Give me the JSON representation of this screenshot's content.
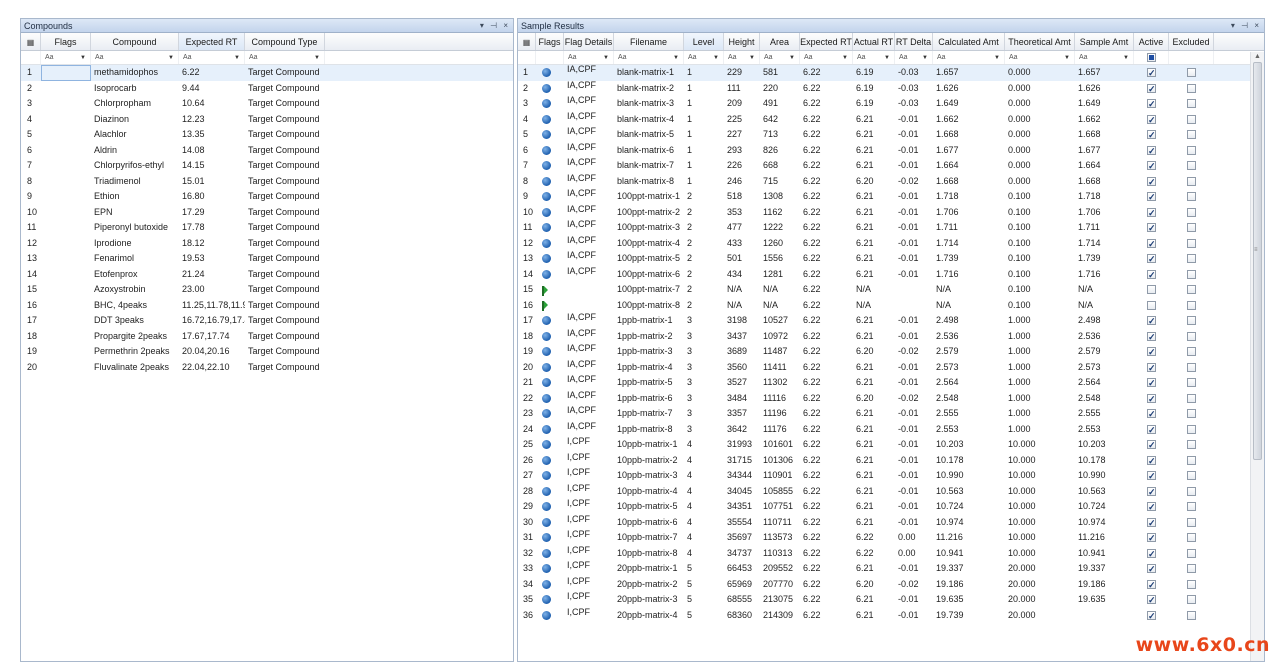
{
  "compounds_panel": {
    "title": "Compounds",
    "columns": [
      "",
      "Flags",
      "Compound",
      "Expected RT",
      "Compound Type"
    ],
    "filter_token": "Aa",
    "rows": [
      [
        "1",
        "",
        "methamidophos",
        "6.22",
        "Target Compound"
      ],
      [
        "2",
        "",
        "Isoprocarb",
        "9.44",
        "Target Compound"
      ],
      [
        "3",
        "",
        "Chlorpropham",
        "10.64",
        "Target Compound"
      ],
      [
        "4",
        "",
        "Diazinon",
        "12.23",
        "Target Compound"
      ],
      [
        "5",
        "",
        "Alachlor",
        "13.35",
        "Target Compound"
      ],
      [
        "6",
        "",
        "Aldrin",
        "14.08",
        "Target Compound"
      ],
      [
        "7",
        "",
        "Chlorpyrifos-ethyl",
        "14.15",
        "Target Compound"
      ],
      [
        "8",
        "",
        "Triadimenol",
        "15.01",
        "Target Compound"
      ],
      [
        "9",
        "",
        "Ethion",
        "16.80",
        "Target Compound"
      ],
      [
        "10",
        "",
        "EPN",
        "17.29",
        "Target Compound"
      ],
      [
        "11",
        "",
        "Piperonyl butoxide",
        "17.78",
        "Target Compound"
      ],
      [
        "12",
        "",
        "Iprodione",
        "18.12",
        "Target Compound"
      ],
      [
        "13",
        "",
        "Fenarimol",
        "19.53",
        "Target Compound"
      ],
      [
        "14",
        "",
        "Etofenprox",
        "21.24",
        "Target Compound"
      ],
      [
        "15",
        "",
        "Azoxystrobin",
        "23.00",
        "Target Compound"
      ],
      [
        "16",
        "",
        "BHC, 4peaks",
        "11.25,11.78,11.9",
        "Target Compound"
      ],
      [
        "17",
        "",
        "DDT 3peaks",
        "16.72,16.79,17.4",
        "Target Compound"
      ],
      [
        "18",
        "",
        "Propargite 2peaks",
        "17.67,17.74",
        "Target Compound"
      ],
      [
        "19",
        "",
        "Permethrin 2peaks",
        "20.04,20.16",
        "Target Compound"
      ],
      [
        "20",
        "",
        "Fluvalinate 2peaks",
        "22.04,22.10",
        "Target Compound"
      ]
    ]
  },
  "results_panel": {
    "title": "Sample Results",
    "columns": [
      "",
      "Flags",
      "Flag Details",
      "Filename",
      "Level",
      "Height",
      "Area",
      "Expected RT",
      "Actual RT",
      "RT Delta",
      "Calculated Amt",
      "Theoretical Amt",
      "Sample Amt",
      "Active",
      "Excluded"
    ],
    "filter_token": "Aa",
    "rows": [
      {
        "n": "1",
        "flag": "dot",
        "fd": "IA,CPF",
        "fn": "blank-matrix-1",
        "lv": "1",
        "h": "229",
        "a": "581",
        "ert": "6.22",
        "art": "6.19",
        "rtd": "-0.03",
        "ca": "1.657",
        "ta": "0.000",
        "sa": "1.657",
        "act": true,
        "exc": false
      },
      {
        "n": "2",
        "flag": "dot",
        "fd": "IA,CPF",
        "fn": "blank-matrix-2",
        "lv": "1",
        "h": "111",
        "a": "220",
        "ert": "6.22",
        "art": "6.19",
        "rtd": "-0.03",
        "ca": "1.626",
        "ta": "0.000",
        "sa": "1.626",
        "act": true,
        "exc": false
      },
      {
        "n": "3",
        "flag": "dot",
        "fd": "IA,CPF",
        "fn": "blank-matrix-3",
        "lv": "1",
        "h": "209",
        "a": "491",
        "ert": "6.22",
        "art": "6.19",
        "rtd": "-0.03",
        "ca": "1.649",
        "ta": "0.000",
        "sa": "1.649",
        "act": true,
        "exc": false
      },
      {
        "n": "4",
        "flag": "dot",
        "fd": "IA,CPF",
        "fn": "blank-matrix-4",
        "lv": "1",
        "h": "225",
        "a": "642",
        "ert": "6.22",
        "art": "6.21",
        "rtd": "-0.01",
        "ca": "1.662",
        "ta": "0.000",
        "sa": "1.662",
        "act": true,
        "exc": false
      },
      {
        "n": "5",
        "flag": "dot",
        "fd": "IA,CPF",
        "fn": "blank-matrix-5",
        "lv": "1",
        "h": "227",
        "a": "713",
        "ert": "6.22",
        "art": "6.21",
        "rtd": "-0.01",
        "ca": "1.668",
        "ta": "0.000",
        "sa": "1.668",
        "act": true,
        "exc": false
      },
      {
        "n": "6",
        "flag": "dot",
        "fd": "IA,CPF",
        "fn": "blank-matrix-6",
        "lv": "1",
        "h": "293",
        "a": "826",
        "ert": "6.22",
        "art": "6.21",
        "rtd": "-0.01",
        "ca": "1.677",
        "ta": "0.000",
        "sa": "1.677",
        "act": true,
        "exc": false
      },
      {
        "n": "7",
        "flag": "dot",
        "fd": "IA,CPF",
        "fn": "blank-matrix-7",
        "lv": "1",
        "h": "226",
        "a": "668",
        "ert": "6.22",
        "art": "6.21",
        "rtd": "-0.01",
        "ca": "1.664",
        "ta": "0.000",
        "sa": "1.664",
        "act": true,
        "exc": false
      },
      {
        "n": "8",
        "flag": "dot",
        "fd": "IA,CPF",
        "fn": "blank-matrix-8",
        "lv": "1",
        "h": "246",
        "a": "715",
        "ert": "6.22",
        "art": "6.20",
        "rtd": "-0.02",
        "ca": "1.668",
        "ta": "0.000",
        "sa": "1.668",
        "act": true,
        "exc": false
      },
      {
        "n": "9",
        "flag": "dot",
        "fd": "IA,CPF",
        "fn": "100ppt-matrix-1",
        "lv": "2",
        "h": "518",
        "a": "1308",
        "ert": "6.22",
        "art": "6.21",
        "rtd": "-0.01",
        "ca": "1.718",
        "ta": "0.100",
        "sa": "1.718",
        "act": true,
        "exc": false
      },
      {
        "n": "10",
        "flag": "dot",
        "fd": "IA,CPF",
        "fn": "100ppt-matrix-2",
        "lv": "2",
        "h": "353",
        "a": "1162",
        "ert": "6.22",
        "art": "6.21",
        "rtd": "-0.01",
        "ca": "1.706",
        "ta": "0.100",
        "sa": "1.706",
        "act": true,
        "exc": false
      },
      {
        "n": "11",
        "flag": "dot",
        "fd": "IA,CPF",
        "fn": "100ppt-matrix-3",
        "lv": "2",
        "h": "477",
        "a": "1222",
        "ert": "6.22",
        "art": "6.21",
        "rtd": "-0.01",
        "ca": "1.711",
        "ta": "0.100",
        "sa": "1.711",
        "act": true,
        "exc": false
      },
      {
        "n": "12",
        "flag": "dot",
        "fd": "IA,CPF",
        "fn": "100ppt-matrix-4",
        "lv": "2",
        "h": "433",
        "a": "1260",
        "ert": "6.22",
        "art": "6.21",
        "rtd": "-0.01",
        "ca": "1.714",
        "ta": "0.100",
        "sa": "1.714",
        "act": true,
        "exc": false
      },
      {
        "n": "13",
        "flag": "dot",
        "fd": "IA,CPF",
        "fn": "100ppt-matrix-5",
        "lv": "2",
        "h": "501",
        "a": "1556",
        "ert": "6.22",
        "art": "6.21",
        "rtd": "-0.01",
        "ca": "1.739",
        "ta": "0.100",
        "sa": "1.739",
        "act": true,
        "exc": false
      },
      {
        "n": "14",
        "flag": "dot",
        "fd": "IA,CPF",
        "fn": "100ppt-matrix-6",
        "lv": "2",
        "h": "434",
        "a": "1281",
        "ert": "6.22",
        "art": "6.21",
        "rtd": "-0.01",
        "ca": "1.716",
        "ta": "0.100",
        "sa": "1.716",
        "act": true,
        "exc": false
      },
      {
        "n": "15",
        "flag": "green",
        "fd": "",
        "fn": "100ppt-matrix-7",
        "lv": "2",
        "h": "N/A",
        "a": "N/A",
        "ert": "6.22",
        "art": "N/A",
        "rtd": "",
        "ca": "N/A",
        "ta": "0.100",
        "sa": "N/A",
        "act": false,
        "exc": false
      },
      {
        "n": "16",
        "flag": "green",
        "fd": "",
        "fn": "100ppt-matrix-8",
        "lv": "2",
        "h": "N/A",
        "a": "N/A",
        "ert": "6.22",
        "art": "N/A",
        "rtd": "",
        "ca": "N/A",
        "ta": "0.100",
        "sa": "N/A",
        "act": false,
        "exc": false
      },
      {
        "n": "17",
        "flag": "dot",
        "fd": "IA,CPF",
        "fn": "1ppb-matrix-1",
        "lv": "3",
        "h": "3198",
        "a": "10527",
        "ert": "6.22",
        "art": "6.21",
        "rtd": "-0.01",
        "ca": "2.498",
        "ta": "1.000",
        "sa": "2.498",
        "act": true,
        "exc": false
      },
      {
        "n": "18",
        "flag": "dot",
        "fd": "IA,CPF",
        "fn": "1ppb-matrix-2",
        "lv": "3",
        "h": "3437",
        "a": "10972",
        "ert": "6.22",
        "art": "6.21",
        "rtd": "-0.01",
        "ca": "2.536",
        "ta": "1.000",
        "sa": "2.536",
        "act": true,
        "exc": false
      },
      {
        "n": "19",
        "flag": "dot",
        "fd": "IA,CPF",
        "fn": "1ppb-matrix-3",
        "lv": "3",
        "h": "3689",
        "a": "11487",
        "ert": "6.22",
        "art": "6.20",
        "rtd": "-0.02",
        "ca": "2.579",
        "ta": "1.000",
        "sa": "2.579",
        "act": true,
        "exc": false
      },
      {
        "n": "20",
        "flag": "dot",
        "fd": "IA,CPF",
        "fn": "1ppb-matrix-4",
        "lv": "3",
        "h": "3560",
        "a": "11411",
        "ert": "6.22",
        "art": "6.21",
        "rtd": "-0.01",
        "ca": "2.573",
        "ta": "1.000",
        "sa": "2.573",
        "act": true,
        "exc": false
      },
      {
        "n": "21",
        "flag": "dot",
        "fd": "IA,CPF",
        "fn": "1ppb-matrix-5",
        "lv": "3",
        "h": "3527",
        "a": "11302",
        "ert": "6.22",
        "art": "6.21",
        "rtd": "-0.01",
        "ca": "2.564",
        "ta": "1.000",
        "sa": "2.564",
        "act": true,
        "exc": false
      },
      {
        "n": "22",
        "flag": "dot",
        "fd": "IA,CPF",
        "fn": "1ppb-matrix-6",
        "lv": "3",
        "h": "3484",
        "a": "11116",
        "ert": "6.22",
        "art": "6.20",
        "rtd": "-0.02",
        "ca": "2.548",
        "ta": "1.000",
        "sa": "2.548",
        "act": true,
        "exc": false
      },
      {
        "n": "23",
        "flag": "dot",
        "fd": "IA,CPF",
        "fn": "1ppb-matrix-7",
        "lv": "3",
        "h": "3357",
        "a": "11196",
        "ert": "6.22",
        "art": "6.21",
        "rtd": "-0.01",
        "ca": "2.555",
        "ta": "1.000",
        "sa": "2.555",
        "act": true,
        "exc": false
      },
      {
        "n": "24",
        "flag": "dot",
        "fd": "IA,CPF",
        "fn": "1ppb-matrix-8",
        "lv": "3",
        "h": "3642",
        "a": "11176",
        "ert": "6.22",
        "art": "6.21",
        "rtd": "-0.01",
        "ca": "2.553",
        "ta": "1.000",
        "sa": "2.553",
        "act": true,
        "exc": false
      },
      {
        "n": "25",
        "flag": "dot",
        "fd": "I,CPF",
        "fn": "10ppb-matrix-1",
        "lv": "4",
        "h": "31993",
        "a": "101601",
        "ert": "6.22",
        "art": "6.21",
        "rtd": "-0.01",
        "ca": "10.203",
        "ta": "10.000",
        "sa": "10.203",
        "act": true,
        "exc": false
      },
      {
        "n": "26",
        "flag": "dot",
        "fd": "I,CPF",
        "fn": "10ppb-matrix-2",
        "lv": "4",
        "h": "31715",
        "a": "101306",
        "ert": "6.22",
        "art": "6.21",
        "rtd": "-0.01",
        "ca": "10.178",
        "ta": "10.000",
        "sa": "10.178",
        "act": true,
        "exc": false
      },
      {
        "n": "27",
        "flag": "dot",
        "fd": "I,CPF",
        "fn": "10ppb-matrix-3",
        "lv": "4",
        "h": "34344",
        "a": "110901",
        "ert": "6.22",
        "art": "6.21",
        "rtd": "-0.01",
        "ca": "10.990",
        "ta": "10.000",
        "sa": "10.990",
        "act": true,
        "exc": false
      },
      {
        "n": "28",
        "flag": "dot",
        "fd": "I,CPF",
        "fn": "10ppb-matrix-4",
        "lv": "4",
        "h": "34045",
        "a": "105855",
        "ert": "6.22",
        "art": "6.21",
        "rtd": "-0.01",
        "ca": "10.563",
        "ta": "10.000",
        "sa": "10.563",
        "act": true,
        "exc": false
      },
      {
        "n": "29",
        "flag": "dot",
        "fd": "I,CPF",
        "fn": "10ppb-matrix-5",
        "lv": "4",
        "h": "34351",
        "a": "107751",
        "ert": "6.22",
        "art": "6.21",
        "rtd": "-0.01",
        "ca": "10.724",
        "ta": "10.000",
        "sa": "10.724",
        "act": true,
        "exc": false
      },
      {
        "n": "30",
        "flag": "dot",
        "fd": "I,CPF",
        "fn": "10ppb-matrix-6",
        "lv": "4",
        "h": "35554",
        "a": "110711",
        "ert": "6.22",
        "art": "6.21",
        "rtd": "-0.01",
        "ca": "10.974",
        "ta": "10.000",
        "sa": "10.974",
        "act": true,
        "exc": false
      },
      {
        "n": "31",
        "flag": "dot",
        "fd": "I,CPF",
        "fn": "10ppb-matrix-7",
        "lv": "4",
        "h": "35697",
        "a": "113573",
        "ert": "6.22",
        "art": "6.22",
        "rtd": "0.00",
        "ca": "11.216",
        "ta": "10.000",
        "sa": "11.216",
        "act": true,
        "exc": false
      },
      {
        "n": "32",
        "flag": "dot",
        "fd": "I,CPF",
        "fn": "10ppb-matrix-8",
        "lv": "4",
        "h": "34737",
        "a": "110313",
        "ert": "6.22",
        "art": "6.22",
        "rtd": "0.00",
        "ca": "10.941",
        "ta": "10.000",
        "sa": "10.941",
        "act": true,
        "exc": false
      },
      {
        "n": "33",
        "flag": "dot",
        "fd": "I,CPF",
        "fn": "20ppb-matrix-1",
        "lv": "5",
        "h": "66453",
        "a": "209552",
        "ert": "6.22",
        "art": "6.21",
        "rtd": "-0.01",
        "ca": "19.337",
        "ta": "20.000",
        "sa": "19.337",
        "act": true,
        "exc": false
      },
      {
        "n": "34",
        "flag": "dot",
        "fd": "I,CPF",
        "fn": "20ppb-matrix-2",
        "lv": "5",
        "h": "65969",
        "a": "207770",
        "ert": "6.22",
        "art": "6.20",
        "rtd": "-0.02",
        "ca": "19.186",
        "ta": "20.000",
        "sa": "19.186",
        "act": true,
        "exc": false
      },
      {
        "n": "35",
        "flag": "dot",
        "fd": "I,CPF",
        "fn": "20ppb-matrix-3",
        "lv": "5",
        "h": "68555",
        "a": "213075",
        "ert": "6.22",
        "art": "6.21",
        "rtd": "-0.01",
        "ca": "19.635",
        "ta": "20.000",
        "sa": "19.635",
        "act": true,
        "exc": false
      },
      {
        "n": "36",
        "flag": "dot",
        "fd": "I,CPF",
        "fn": "20ppb-matrix-4",
        "lv": "5",
        "h": "68360",
        "a": "214309",
        "ert": "6.22",
        "art": "6.21",
        "rtd": "-0.01",
        "ca": "19.739",
        "ta": "20.000",
        "sa": "",
        "act": true,
        "exc": false
      }
    ]
  },
  "watermark": "www.6x0.cn"
}
